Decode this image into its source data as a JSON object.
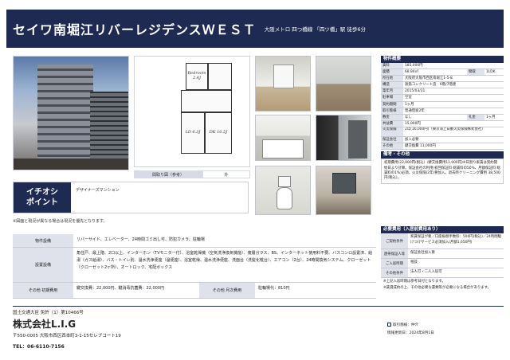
{
  "header": {
    "title": "セイワ南堀江リバーレジデンスＷＥＳＴ",
    "access": "大阪メトロ 四つ橋線 「四ツ橋」駅 徒歩6分"
  },
  "floorplan": {
    "rooms": [
      "Bedroom 2.4J",
      "LD 6.3J",
      "DK 10.5J"
    ],
    "caption_left": "間取り図（参考）",
    "caption_right": "外"
  },
  "outline": {
    "title": "物件概要",
    "rows": [
      {
        "k": "賃料",
        "v": "185,000円"
      },
      {
        "k": "面積",
        "v": "68.84㎡",
        "k2": "間取",
        "v2": "1LDK"
      },
      {
        "k": "所在地",
        "v": "大阪府大阪市西区南堀江1-5-8"
      },
      {
        "k": "構造",
        "v": "鉄筋コンクリート造　6階/7階建"
      },
      {
        "k": "築年月",
        "v": "2015/03/31"
      },
      {
        "k": "駐車場",
        "v": "空室"
      },
      {
        "k": "契約期間",
        "v": "1ヶ月"
      },
      {
        "k": "取引態様",
        "v": "普通借家2年"
      },
      {
        "k": "敷金",
        "v": "なし",
        "k2": "礼金",
        "v2": "1ヶ月"
      },
      {
        "k": "共益費",
        "v": "15,000円"
      },
      {
        "k": "火災保険",
        "v": "2年(16,000円)（東京海上日動火災保険株式会社）",
        "tall": true
      },
      {
        "k": "保証会社",
        "v": "加入必要"
      },
      {
        "k": "その他",
        "v": "鍵交換費 11,000円"
      }
    ],
    "notes_title": "備考・その他",
    "notes": "初期費用(22,000円(税込）/鍵交換費用11,000円)※日割り家賃は契約開始日より計算。保証会社の利用(初回保証料 総賃料の50%、月額保証料 総賃料の1%)必須。火災保険(2年)要加入。退去時クリーニング費用 38,500円(税込)。"
  },
  "catch": {
    "head_line1": "イチオシ",
    "head_line2": "ポイント",
    "body": "デザイナーズマンション"
  },
  "warning": "※図面と現況が異なる場合は現況を優先となります。",
  "equipment": {
    "rows": [
      {
        "k": "物件設備",
        "v": "リバーサイド、エレベーター、24時間ゴミ出し可、防犯カメラ、駐輪場"
      },
      {
        "k": "設置設備",
        "v": "角住戸、最上階、2口以上、インターホン（TVモニター付）、浴室乾燥機（空気洗浄換気機能）、複層ガラス、BS、インターネット使用料不要、バスコンロ設置済、給湯（ガス給湯）、バス・トイレ別、温水洗浄便座（温便座）、浴室乾燥、温水洗浄便座、洗面台（洗髪化粧台）、エアコン（2台）、24時間換気システム、クローゼット（クローゼット2ヶ所）、オートロック、宅配ボックス"
      },
      {
        "k": "その他 初期費用",
        "v": "鍵交換費：22,000円、鍵消毒抗菌費：22,000円",
        "k2": "その他 月次費用",
        "v2": "駐輪場代：810円"
      }
    ]
  },
  "costs": {
    "title": "必要費用（入居前費用あり）",
    "rows": [
      {
        "k": "ご契約条件",
        "v": "家賃保証が要／口座振替手数料：500円(税込)／24時間駆けつけサービス必須加入(月額1,650円)"
      },
      {
        "k": "連帯保証人等",
        "v": "保証会社加入要"
      },
      {
        "k": "ご入居時期",
        "v": "相談"
      },
      {
        "k": "その他条件",
        "v": "法人可・二人入居可"
      }
    ],
    "note1": "※上記入居時期は参考日付となります。",
    "note2": "※賃貸成約の上、その他必要な書類等が必要になる場合があります。"
  },
  "footer": {
    "license": "国土交通大臣 免許（1）第10466号",
    "company": "株式会社L.I.G",
    "address": "〒550-0005 大阪市西区西本町3-1-15セレブコート19",
    "tel": "TEL：06-6110-7156",
    "meta1": "取引態様：仲介",
    "meta2": "情報更新日：2024年8月1日"
  }
}
